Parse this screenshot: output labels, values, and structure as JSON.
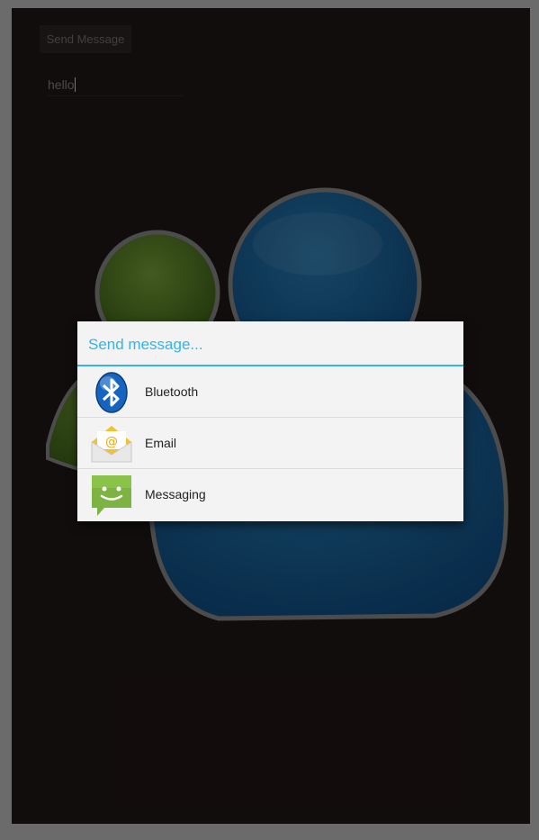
{
  "app": {
    "send_button_label": "Send Message",
    "message_input_value": "hello"
  },
  "dialog": {
    "title": "Send message...",
    "items": [
      {
        "label": "Bluetooth",
        "icon": "bluetooth-icon"
      },
      {
        "label": "Email",
        "icon": "email-icon"
      },
      {
        "label": "Messaging",
        "icon": "messaging-icon"
      }
    ]
  },
  "colors": {
    "accent": "#33b5e5",
    "background": "#201816",
    "frame": "#6b6b6b"
  }
}
